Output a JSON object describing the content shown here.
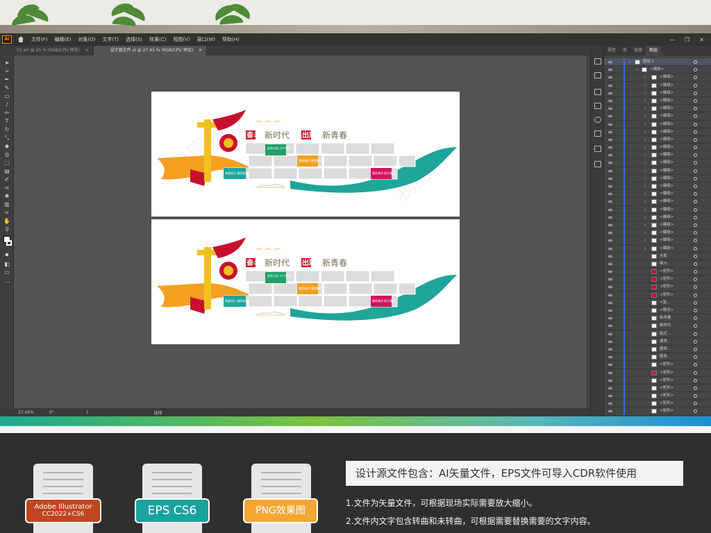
{
  "menubar": {
    "app_logo": "Ai",
    "items": [
      "文件(F)",
      "编辑(E)",
      "对象(O)",
      "文字(T)",
      "选择(S)",
      "效果(C)",
      "视图(V)",
      "窗口(W)",
      "帮助(H)"
    ],
    "window_controls": [
      "—",
      "❐",
      "✕"
    ]
  },
  "tabs": [
    {
      "label": "01.ai* @ 25 % (RGB/CPU 预览)",
      "close": "✕"
    },
    {
      "label": "设计源文件.ai @ 27.45 % (RGB/CPU 预览)",
      "close": "✕"
    }
  ],
  "statusbar": {
    "zoom": "27.45%",
    "angle": "0°",
    "artboard": "1",
    "tool": "选择"
  },
  "layers_panel": {
    "tabs": [
      "属性",
      "库",
      "链接",
      "图层"
    ],
    "rows": [
      {
        "label": "图层 1",
        "kind": "layer"
      },
      {
        "label": "<编组>",
        "kind": "group"
      },
      {
        "label": "<编组>",
        "kind": "sub"
      },
      {
        "label": "<编组>",
        "kind": "sub"
      },
      {
        "label": "<编组>",
        "kind": "sub"
      },
      {
        "label": "<编组>",
        "kind": "sub"
      },
      {
        "label": "<编组>",
        "kind": "sub"
      },
      {
        "label": "<编组>",
        "kind": "sub"
      },
      {
        "label": "<编组>",
        "kind": "sub"
      },
      {
        "label": "<编组>",
        "kind": "sub"
      },
      {
        "label": "<编组>",
        "kind": "sub"
      },
      {
        "label": "<编组>",
        "kind": "sub"
      },
      {
        "label": "<编组>",
        "kind": "sub"
      },
      {
        "label": "<编组>",
        "kind": "sub"
      },
      {
        "label": "<编组>",
        "kind": "sub"
      },
      {
        "label": "<编组>",
        "kind": "sub"
      },
      {
        "label": "<编组>",
        "kind": "sub"
      },
      {
        "label": "<编组>",
        "kind": "sub"
      },
      {
        "label": "<编组>",
        "kind": "sub"
      },
      {
        "label": "<编组>",
        "kind": "sub"
      },
      {
        "label": "<编组>",
        "kind": "sub"
      },
      {
        "label": "<编组>",
        "kind": "sub"
      },
      {
        "label": "<编组>",
        "kind": "sub"
      },
      {
        "label": "<编组>",
        "kind": "sub"
      },
      {
        "label": "<编组>",
        "kind": "sub"
      },
      {
        "label": "光影",
        "kind": "plain"
      },
      {
        "label": "奋斗",
        "kind": "plain"
      },
      {
        "label": "<矩形>",
        "kind": "red"
      },
      {
        "label": "<矩形>",
        "kind": "red"
      },
      {
        "label": "<矩形>",
        "kind": "red"
      },
      {
        "label": "<矩形>",
        "kind": "red"
      },
      {
        "label": "<复...",
        "kind": "plain"
      },
      {
        "label": "<路径>",
        "kind": "plain"
      },
      {
        "label": "新青春",
        "kind": "plain"
      },
      {
        "label": "新时代",
        "kind": "plain"
      },
      {
        "label": "贴近...",
        "kind": "plain"
      },
      {
        "label": "请党...",
        "kind": "plain"
      },
      {
        "label": "服务...",
        "kind": "plain"
      },
      {
        "label": "服务...",
        "kind": "plain"
      },
      {
        "label": "<矩形>",
        "kind": "plain"
      },
      {
        "label": "<矩形>",
        "kind": "pink"
      },
      {
        "label": "<矩形>",
        "kind": "plain"
      },
      {
        "label": "<矩形>",
        "kind": "plain"
      },
      {
        "label": "<矩形>",
        "kind": "plain"
      },
      {
        "label": "<矩形>",
        "kind": "plain"
      },
      {
        "label": "<矩形>",
        "kind": "plain"
      }
    ]
  },
  "artwork": {
    "title_part1_box": "奋斗",
    "title_part1_rest": "新时代",
    "title_part2_box": "出彩",
    "title_part2_rest": "新青春",
    "labels": [
      "坚命大局 人产创团",
      "凝塑青年 凝思青年",
      "青塑初心 强国奋进",
      "服务青年 助力青年"
    ],
    "colors": {
      "red": "#c8102e",
      "orange": "#f4a020",
      "teal": "#20a59a",
      "green": "#21a06a",
      "yellow": "#f0c020",
      "pink": "#d4145a",
      "tile": "#dcdcdc"
    }
  },
  "bottom": {
    "badges": [
      {
        "line1": "Adobe Illustrator",
        "line2": "CC2022+CS6",
        "color": "#c0461f"
      },
      {
        "line1": "EPS CS6",
        "line2": "",
        "color": "#1aa3a0"
      },
      {
        "line1": "PNG效果图",
        "line2": "",
        "color": "#f3a733"
      }
    ],
    "info_title": "设计源文件包含：AI矢量文件，EPS文件可导入CDR软件使用",
    "info_lines": [
      "1.文件为矢量文件，可根据现场实际需要放大缩小。",
      "2.文件内文字包含转曲和未转曲，可根据需要替换需要的文字内容。"
    ]
  }
}
